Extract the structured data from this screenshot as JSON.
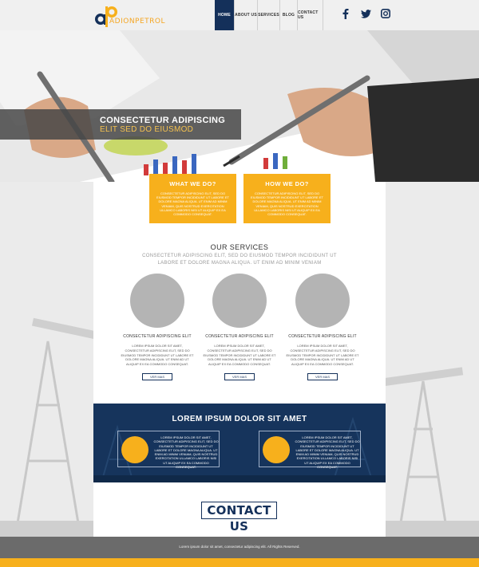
{
  "brand": {
    "logo_text": "ADIONPETROL"
  },
  "nav": {
    "items": [
      {
        "label": "HOME",
        "active": true
      },
      {
        "label": "ABOUT US",
        "active": false
      },
      {
        "label": "SERVICES",
        "active": false
      },
      {
        "label": "BLOG",
        "active": false
      },
      {
        "label": "CONTACT US",
        "active": false
      }
    ]
  },
  "social": [
    "facebook-icon",
    "twitter-icon",
    "instagram-icon"
  ],
  "hero": {
    "title": "CONSECTETUR ADIPISCING",
    "subtitle": "ELIT SED DO EIUSMOD"
  },
  "info_boxes": [
    {
      "title": "WHAT WE DO?",
      "text": "Consectetur adipiscing elit, sed do eiusmod tempor incididunt ut labore et dolore magna aliqua. Ut enim ad minim veniam, quis nostrud exercitation ullamco laboris nisi ut aliquip ex ea commodo consequat."
    },
    {
      "title": "HOW WE DO?",
      "text": "Consectetur adipiscing elit, sed do eiusmod tempor incididunt ut labore et dolore magna aliqua. Ut enim ad minim veniam, quis nostrud exercitation ullamco laboris nisi ut aliquip ex ea commodo consequat."
    }
  ],
  "services": {
    "title": "OUR SERVICES",
    "subtitle": "Consectetur adipiscing elit, sed do eiusmod tempor incididunt ut labore et dolore magna aliqua. Ut enim ad minim veniam",
    "items": [
      {
        "title": "CONSECTETUR ADIPISCING ELIT",
        "text": "Lorem ipsum dolor sit amet, consectetur adipiscing elit, sed do eiusmod tempor incididunt ut labore et dolore magna aliqua. Ut enim ad ut aliquip ex ea commodo consequat.",
        "button": "VER MAS"
      },
      {
        "title": "CONSECTETUR ADIPISCING ELIT",
        "text": "Lorem ipsum dolor sit amet, consectetur adipiscing elit, sed do eiusmod tempor incididunt ut labore et dolore magna aliqua. Ut enim ad ut aliquip ex ea commodo consequat.",
        "button": "VER MAS"
      },
      {
        "title": "CONSECTETUR ADIPISCING ELIT",
        "text": "Lorem ipsum dolor sit amet, consectetur adipiscing elit, sed do eiusmod tempor incididunt ut labore et dolore magna aliqua. Ut enim ad ut aliquip ex ea commodo consequat.",
        "button": "VER MAS"
      }
    ]
  },
  "band": {
    "title": "LOREM IPSUM DOLOR SIT AMET",
    "cards": [
      {
        "text": "Lorem ipsum dolor sit amet, consectetur adipiscing elit, sed do eiusmod tempor incididunt ut labore et dolore magna aliqua. Ut enim ad minim veniam, quis nostrud exercitation ullamco laboris nisi ut aliquip ex ea commodo consequat."
      },
      {
        "text": "Lorem ipsum dolor sit amet, consectetur adipiscing elit, sed do eiusmod tempor incididunt ut labore et dolore magna aliqua. Ut enim ad minim veniam, quis nostrud exercitation ullamco laboris nisi ut aliquip ex ea commodo consequat."
      }
    ]
  },
  "contact": {
    "label": "CONTACT US"
  },
  "footer": {
    "text": "Lorem ipsum dolor sit amet, consectetur adipiscing elit. All Rights Reserved."
  },
  "colors": {
    "navy": "#14305a",
    "accent": "#f7b01c",
    "footer": "#6b6b6b"
  }
}
